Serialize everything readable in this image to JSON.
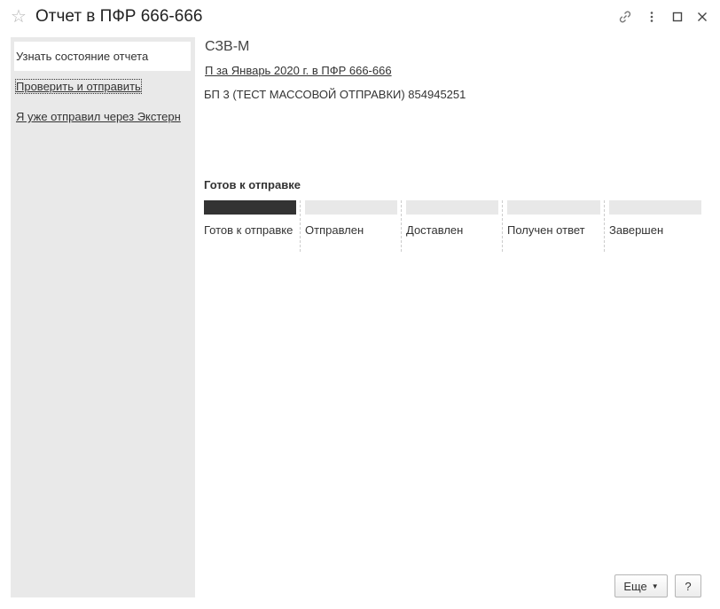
{
  "window": {
    "title": "Отчет в ПФР 666-666",
    "favorite_icon": "star-icon",
    "toolbar_icons": [
      "link-icon",
      "more-vertical-icon",
      "maximize-icon",
      "close-icon"
    ]
  },
  "sidebar": {
    "items": [
      {
        "label": "Узнать состояние отчета",
        "active": true
      },
      {
        "label": "Проверить и отправить",
        "focused": true
      },
      {
        "label": "Я уже отправил через Экстерн"
      }
    ]
  },
  "report": {
    "form_name": "СЗВ-М",
    "period_link": "П за Январь 2020 г. в ПФР 666-666",
    "organization": "БП 3 (ТЕСТ МАССОВОЙ ОТПРАВКИ) 854945251"
  },
  "status": {
    "current": "Готов к отправке",
    "progress_completed_stages": 1,
    "stages": [
      {
        "label": "Готов к отправке",
        "done": true
      },
      {
        "label": "Отправлен",
        "done": false
      },
      {
        "label": "Доставлен",
        "done": false
      },
      {
        "label": "Получен ответ",
        "done": false
      },
      {
        "label": "Завершен",
        "done": false
      }
    ]
  },
  "footer": {
    "more_label": "Еще",
    "help_label": "?"
  },
  "colors": {
    "sidebar_bg": "#e9e9e9",
    "stage_done": "#333333",
    "stage_pending": "#e8e8e8"
  }
}
